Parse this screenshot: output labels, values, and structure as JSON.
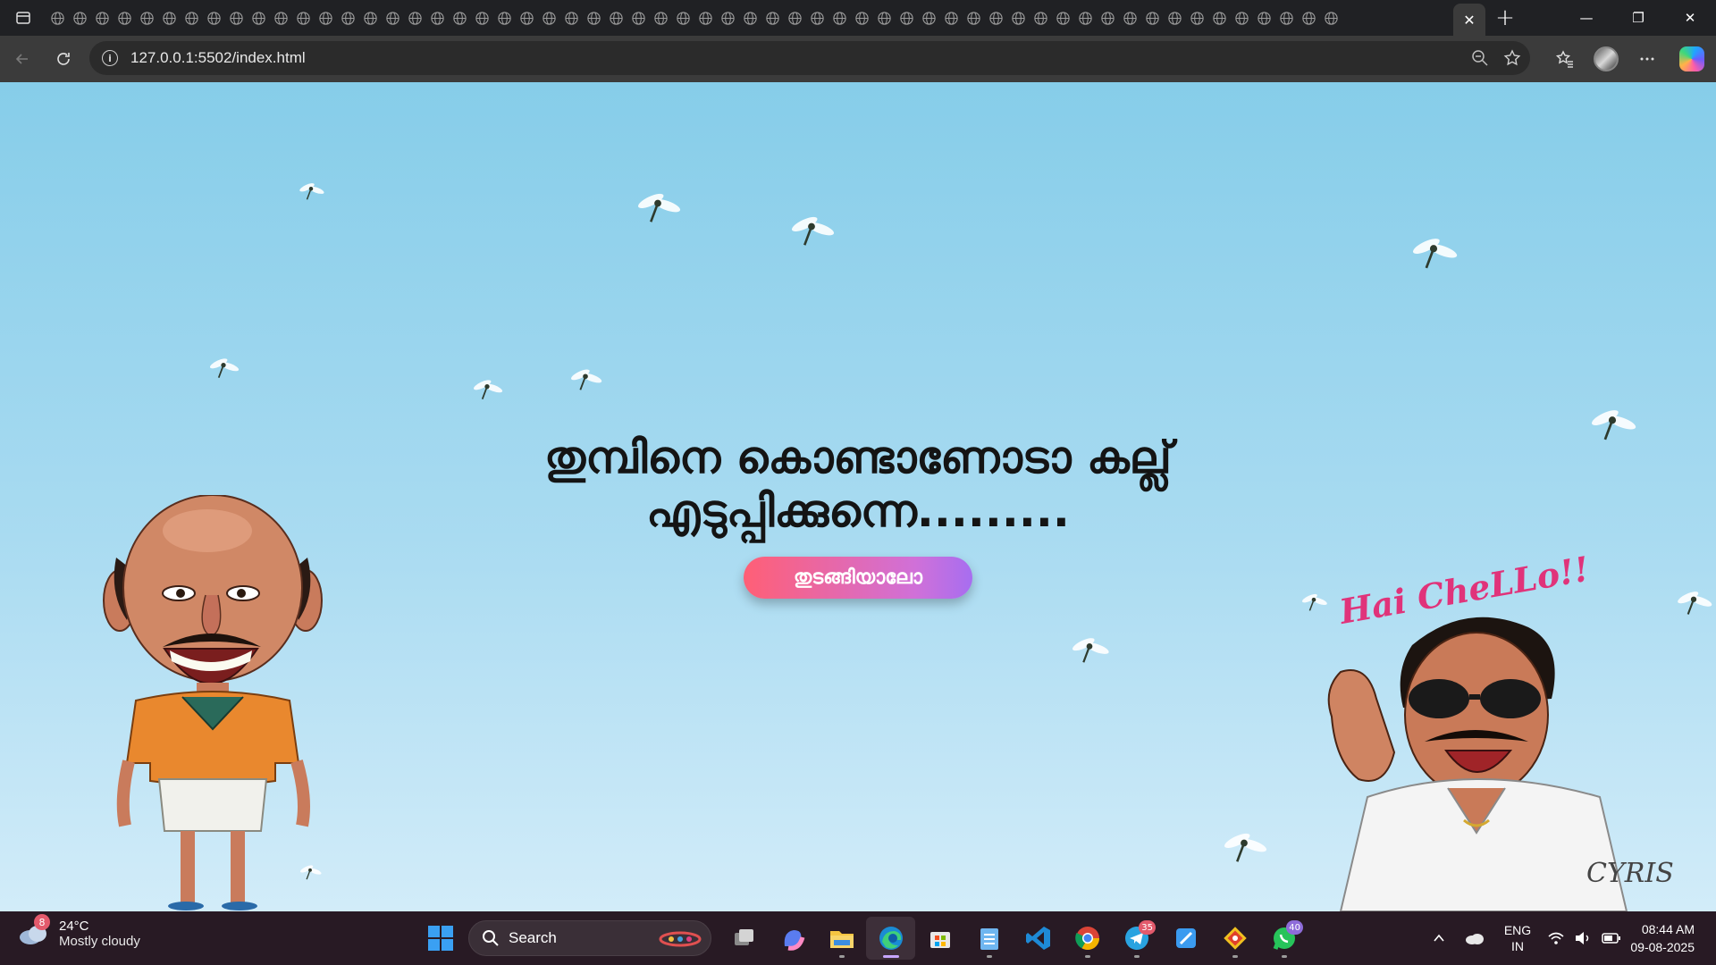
{
  "browser": {
    "url": "127.0.0.1:5502/index.html",
    "tab_count": 58,
    "active_tab_close": "✕",
    "new_tab": "+",
    "window_controls": {
      "minimize": "—",
      "restore": "❐",
      "close": "✕"
    },
    "icons": [
      "sidebar-icon",
      "back-icon",
      "refresh-icon",
      "info-icon",
      "zoom-out-icon",
      "favorite-star-icon",
      "favorites-icon",
      "profile-avatar",
      "more-icon",
      "copilot-icon"
    ]
  },
  "page": {
    "headline_line1": "തുമ്പിനെ കൊണ്ടാണോടാ കല്ല്",
    "headline_line2": "എടുപ്പിക്കുന്നെ.........",
    "start_button": "തുടങ്ങിയാലോ",
    "sticker_text": "Hai CheLLo!!",
    "signature": "CYRIS",
    "colors": {
      "sky_top": "#86cde9",
      "sky_bottom": "#d2ecf9",
      "button_start": "#ff5f76",
      "button_end": "#a76ef0",
      "sticker_text": "#e0337a"
    }
  },
  "taskbar": {
    "weather": {
      "badge": "8",
      "temp": "24°C",
      "condition": "Mostly cloudy"
    },
    "search_label": "Search",
    "apps": [
      {
        "name": "task-view"
      },
      {
        "name": "copilot-app"
      },
      {
        "name": "file-explorer"
      },
      {
        "name": "edge-browser",
        "active": true
      },
      {
        "name": "microsoft-store"
      },
      {
        "name": "notepad"
      },
      {
        "name": "vscode"
      },
      {
        "name": "chrome"
      },
      {
        "name": "telegram",
        "badge": "35"
      },
      {
        "name": "paint"
      },
      {
        "name": "git-app"
      },
      {
        "name": "whatsapp",
        "badge": "40"
      }
    ],
    "tray": {
      "lang1": "ENG",
      "lang2": "IN",
      "time": "08:44 AM",
      "date": "09-08-2025"
    }
  }
}
